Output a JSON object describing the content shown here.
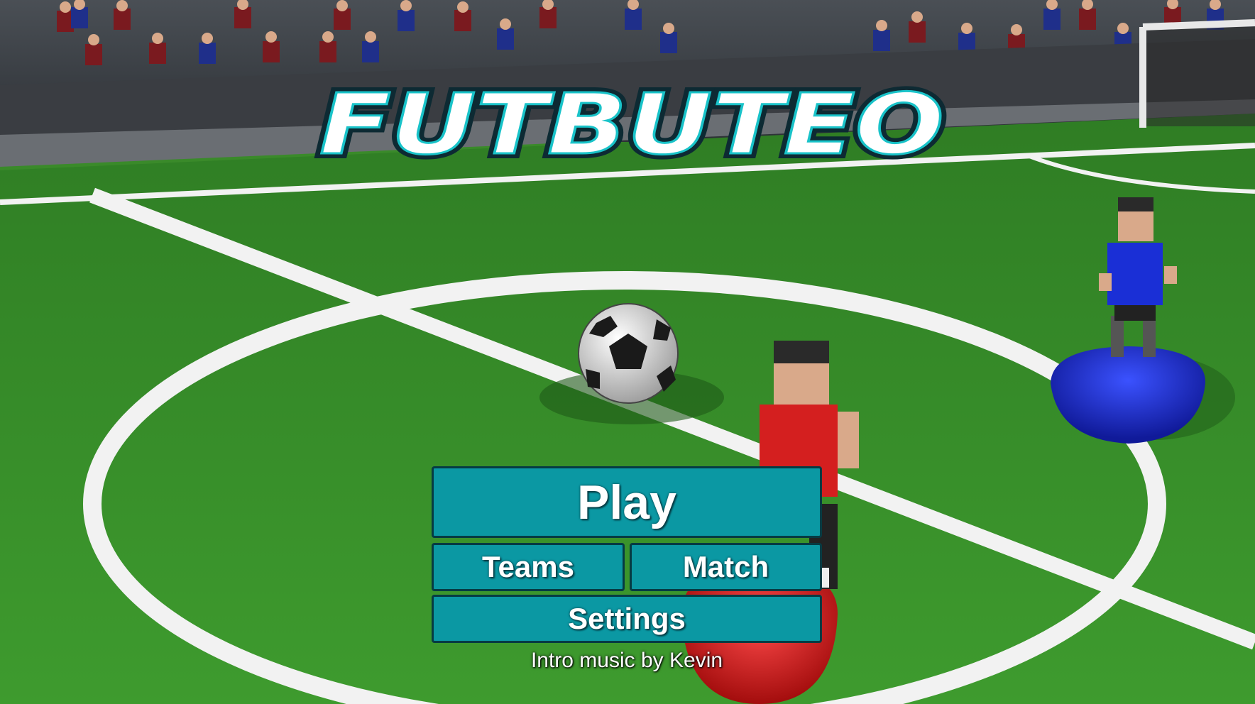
{
  "game": {
    "title": "FUTBUTEO"
  },
  "menu": {
    "play_label": "Play",
    "teams_label": "Teams",
    "match_label": "Match",
    "settings_label": "Settings"
  },
  "credit": "Intro music by Kevin",
  "colors": {
    "button_fill": "#0b98a3",
    "button_border": "#063b43",
    "grass": "#3a8a2a",
    "home_team": "#d41f1f",
    "away_team": "#1f2fd4"
  }
}
